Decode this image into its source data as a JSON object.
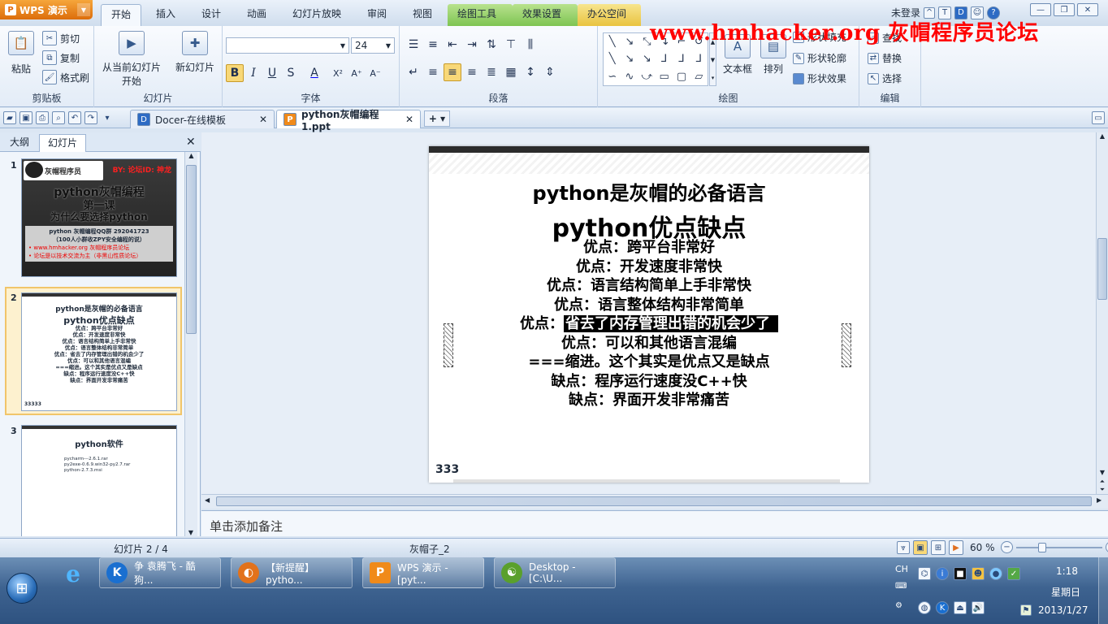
{
  "app": {
    "menu_label": "WPS 演示",
    "logo_glyph": "P"
  },
  "ribbon_tabs": [
    "开始",
    "插入",
    "设计",
    "动画",
    "幻灯片放映",
    "审阅",
    "视图"
  ],
  "context_tabs": [
    "绘图工具",
    "效果设置",
    "办公空间"
  ],
  "title_right": {
    "login": "未登录"
  },
  "watermark": "www.hmhacker.org 灰帽程序员论坛",
  "ribbon": {
    "clipboard": {
      "paste": "粘贴",
      "cut": "剪切",
      "copy": "复制",
      "format_painter": "格式刷",
      "label": "剪贴板"
    },
    "slides": {
      "from_current": "从当前幻灯片",
      "start": "开始",
      "new_slide": "新幻灯片",
      "label": "幻灯片"
    },
    "font": {
      "size": "24",
      "bold": "B",
      "italic": "I",
      "underline": "U",
      "strike": "S",
      "color": "A",
      "label": "字体"
    },
    "paragraph": {
      "label": "段落"
    },
    "drawing": {
      "textbox": "文本框",
      "arrange": "排列",
      "shape_fill": "形状填充",
      "shape_outline": "形状轮廓",
      "shape_effect": "形状效果",
      "label": "绘图"
    },
    "editing": {
      "find": "查找",
      "replace": "替换",
      "select": "选择",
      "label": "编辑"
    }
  },
  "doc_tabs": [
    {
      "label": "Docer-在线模板",
      "icon": "D"
    },
    {
      "label": "python灰帽编程1.ppt",
      "icon": "P"
    }
  ],
  "panel": {
    "tabs": [
      "大纲",
      "幻灯片"
    ],
    "thumbs": [
      {
        "num": "1",
        "by": "BY: 论坛ID: 神龙",
        "logo": "灰帽程序员",
        "title1": "python灰帽编程",
        "title2": "第一课",
        "title3": "为什么要选择python",
        "info1": "python 灰帽编程QQ群 292041723",
        "info2": "（100人小群收ZPY安全编程的说）",
        "info3": "• www.hmhacker.org 灰帽程序员论坛",
        "info4": "• 论坛是以技术交流为主（非黑山性质论坛）"
      },
      {
        "num": "2",
        "lines": [
          "python是灰帽的必备语言",
          "python优点缺点",
          "优点：跨平台非常好",
          "优点：开发速度非常快",
          "优点：语言结构简单上手非常快",
          "优点：语言整体结构非常简单",
          "优点：省去了内存管理出错的机会少了",
          "优点：可以和其他语言混编",
          "===缩进。这个其实是优点又是缺点",
          "缺点：程序运行速度没C++快",
          "缺点：界面开发非常痛苦"
        ],
        "corner": "33333"
      },
      {
        "num": "3",
        "title": "python软件",
        "items": [
          "pycharm---2.6.1.rar",
          "py2exe-0.6.9.win32-py2.7.rar",
          "python-2.7.3.msi"
        ]
      }
    ]
  },
  "slide": {
    "title1": "python是灰帽的必备语言",
    "title2": "python优点缺点",
    "bullets": [
      {
        "text": "优点：跨平台非常好"
      },
      {
        "text": "优点：开发速度非常快"
      },
      {
        "text": "优点：语言结构简单上手非常快"
      },
      {
        "text": "优点：语言整体结构非常简单"
      },
      {
        "prefix": "优点：",
        "highlight": "省去了内存管理出错的机会少了"
      },
      {
        "text": "优点：可以和其他语言混编"
      },
      {
        "text": "===缩进。这个其实是优点又是缺点"
      },
      {
        "text": "缺点：程序运行速度没C++快"
      },
      {
        "text": "缺点：界面开发非常痛苦"
      }
    ],
    "corner_text": "333"
  },
  "notes_placeholder": "单击添加备注",
  "status": {
    "slide_index": "幻灯片 2 / 4",
    "template": "灰帽子_2",
    "zoom": "60 %",
    "zoom_fraction": 0.3
  },
  "taskbar": {
    "items": [
      {
        "label": "争 袁腾飞 - 酷狗...",
        "glyph": "K",
        "color": "#1a6fd0"
      },
      {
        "label": "【新提醒】pytho...",
        "glyph": "◐",
        "color": "#e2721b"
      },
      {
        "label": "WPS 演示 - [pyt...",
        "glyph": "P",
        "color": "#f08a1a"
      },
      {
        "label": "Desktop - [C:\\U...",
        "glyph": "☯",
        "color": "#5aa02c"
      }
    ],
    "lang": "CH",
    "time": "1:18",
    "weekday": "星期日",
    "date": "2013/1/27"
  }
}
